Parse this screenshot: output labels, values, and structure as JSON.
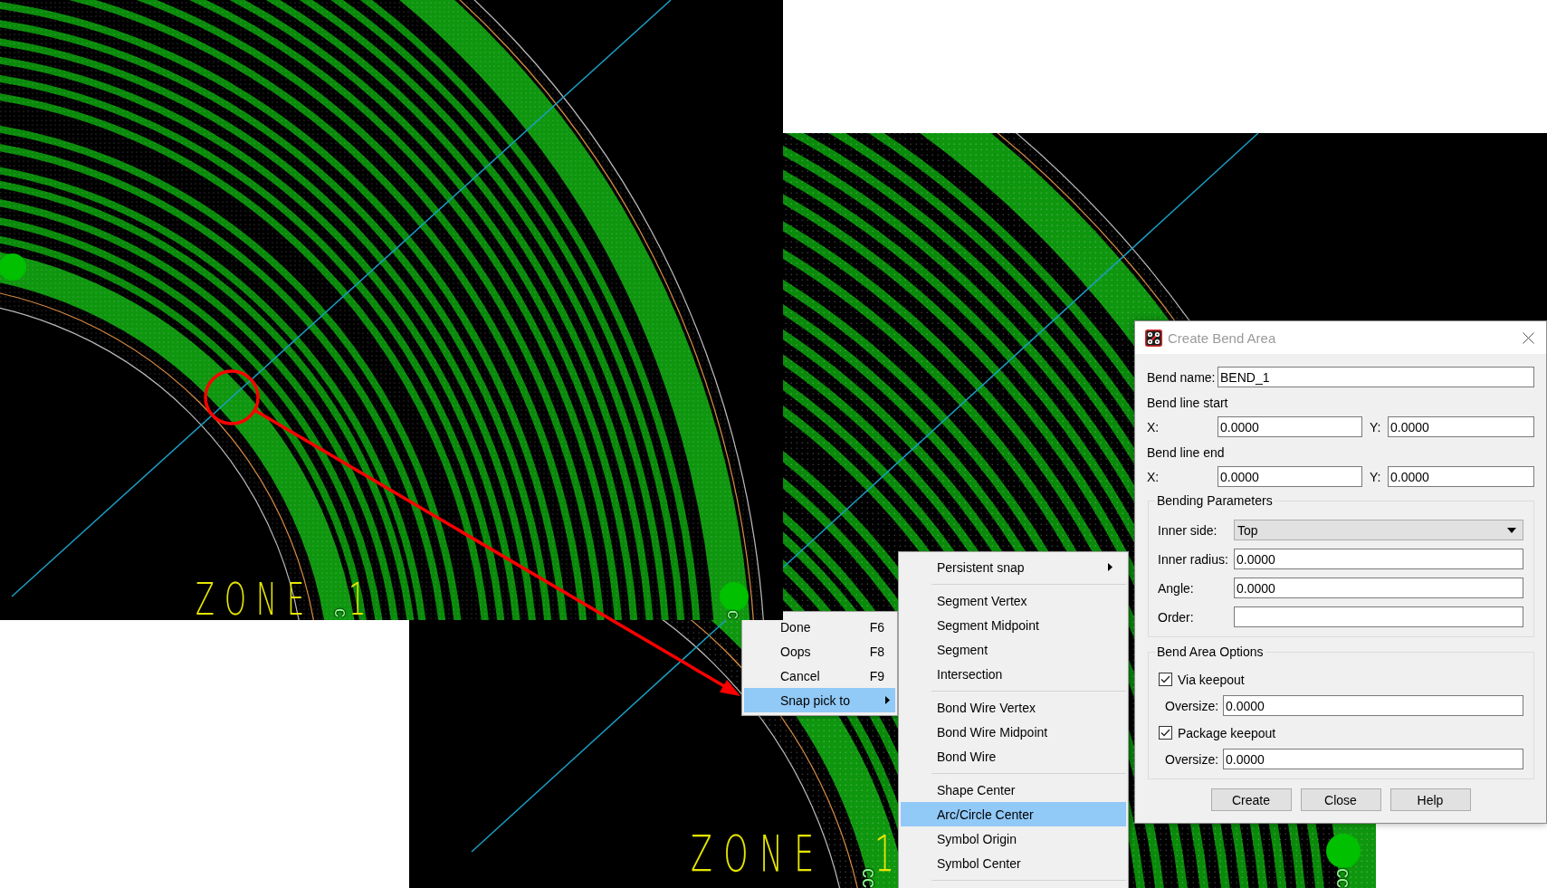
{
  "left_view": {
    "zone_label": "ZONE",
    "zone_number": "1",
    "net_labels": [
      "c",
      "c"
    ]
  },
  "right_view": {
    "zone_label": "ZONE",
    "zone_number": "1",
    "net_labels": [
      "cc",
      "cc"
    ]
  },
  "context_menu": {
    "items": [
      {
        "kind": "item",
        "label": "Done",
        "shortcut": "F6",
        "selected": false
      },
      {
        "kind": "item",
        "label": "Oops",
        "shortcut": "F8",
        "selected": false
      },
      {
        "kind": "item",
        "label": "Cancel",
        "shortcut": "F9",
        "selected": false
      },
      {
        "kind": "submenu",
        "label": "Snap pick to",
        "selected": true
      }
    ]
  },
  "snap_submenu": {
    "items": [
      {
        "kind": "submenu",
        "label": "Persistent snap",
        "selected": false
      },
      {
        "kind": "separator"
      },
      {
        "kind": "item",
        "label": "Segment Vertex",
        "selected": false
      },
      {
        "kind": "item",
        "label": "Segment Midpoint",
        "selected": false
      },
      {
        "kind": "item",
        "label": "Segment",
        "selected": false
      },
      {
        "kind": "item",
        "label": "Intersection",
        "selected": false
      },
      {
        "kind": "separator"
      },
      {
        "kind": "item",
        "label": "Bond Wire Vertex",
        "selected": false
      },
      {
        "kind": "item",
        "label": "Bond Wire Midpoint",
        "selected": false
      },
      {
        "kind": "item",
        "label": "Bond Wire",
        "selected": false
      },
      {
        "kind": "separator"
      },
      {
        "kind": "item",
        "label": "Shape Center",
        "selected": false
      },
      {
        "kind": "item",
        "label": "Arc/Circle Center",
        "selected": true
      },
      {
        "kind": "item",
        "label": "Symbol Origin",
        "selected": false
      },
      {
        "kind": "item",
        "label": "Symbol Center",
        "selected": false
      },
      {
        "kind": "separator"
      }
    ]
  },
  "dialog": {
    "title": "Create Bend Area",
    "bend_name": {
      "label": "Bend name:",
      "value": "BEND_1"
    },
    "bend_line_start": {
      "heading": "Bend line start",
      "x": {
        "label": "X:",
        "value": "0.0000"
      },
      "y": {
        "label": "Y:",
        "value": "0.0000"
      }
    },
    "bend_line_end": {
      "heading": "Bend line end",
      "x": {
        "label": "X:",
        "value": "0.0000"
      },
      "y": {
        "label": "Y:",
        "value": "0.0000"
      }
    },
    "bending_parameters": {
      "title": "Bending Parameters",
      "fields": [
        {
          "kind": "dropdown",
          "label": "Inner side:",
          "value": "Top"
        },
        {
          "kind": "text",
          "label": "Inner radius:",
          "value": "0.0000"
        },
        {
          "kind": "text",
          "label": "Angle:",
          "value": "0.0000"
        },
        {
          "kind": "text",
          "label": "Order:"
        }
      ]
    },
    "bend_area_options": {
      "title": "Bend Area Options",
      "options": [
        {
          "label": "Via keepout",
          "checked": true,
          "oversize": {
            "label": "Oversize:",
            "value": "0.0000"
          }
        },
        {
          "label": "Package keepout",
          "checked": true,
          "oversize": {
            "label": "Oversize:",
            "value": "0.0000"
          }
        }
      ]
    },
    "buttons": [
      "Create",
      "Close",
      "Help"
    ]
  }
}
